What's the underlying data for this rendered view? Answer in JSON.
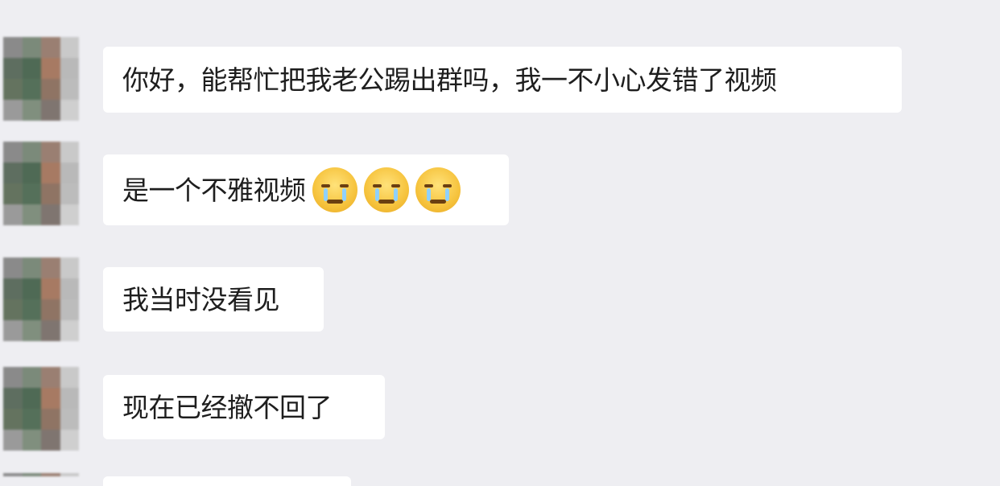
{
  "messages": [
    {
      "text": "你好，能帮忙把我老公踢出群吗，我一不小心发错了视频",
      "emojis": []
    },
    {
      "text": "是一个不雅视频",
      "emojis": [
        "crying-face",
        "crying-face",
        "crying-face"
      ]
    },
    {
      "text": "我当时没看见",
      "emojis": []
    },
    {
      "text": "现在已经撤不回了",
      "emojis": []
    }
  ],
  "colors": {
    "background": "#eeeef2",
    "bubble": "#ffffff",
    "text": "#1e1e1e"
  }
}
